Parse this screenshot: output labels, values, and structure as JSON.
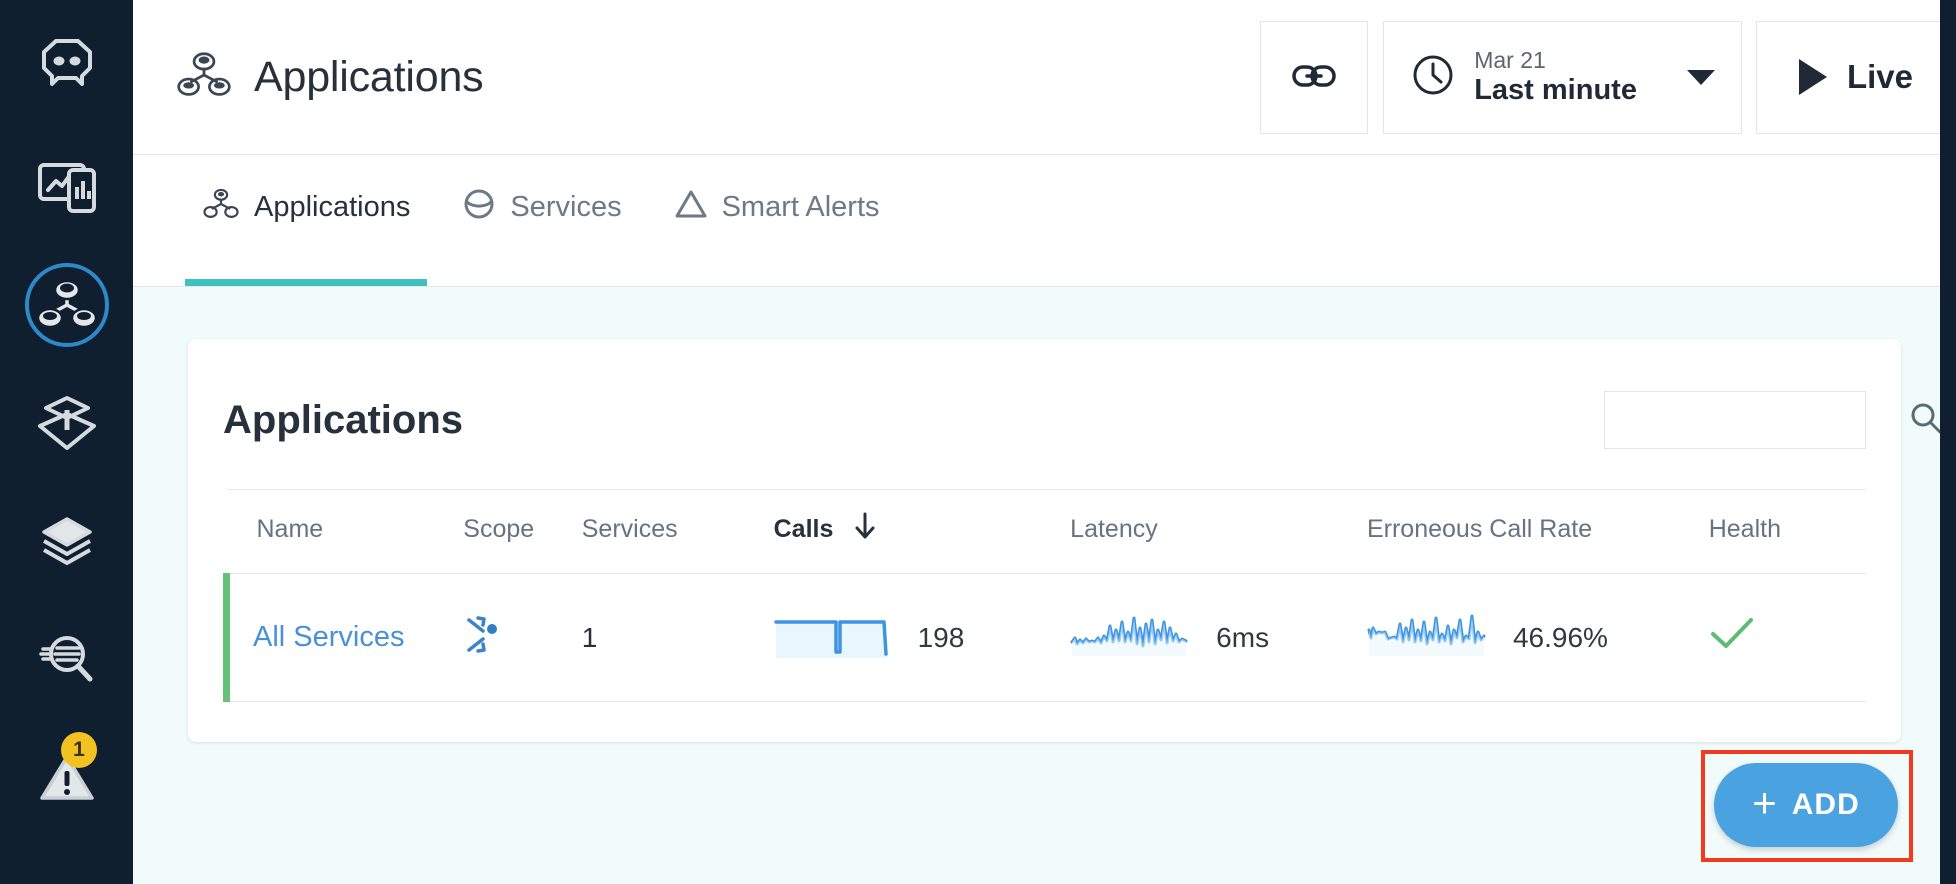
{
  "sidebar": {
    "items": [
      {
        "name": "logo",
        "icon": "robot-logo-icon",
        "label": ""
      },
      {
        "name": "dashboards",
        "icon": "dashboard-icon",
        "label": ""
      },
      {
        "name": "applications",
        "icon": "applications-icon",
        "label": "",
        "active": true
      },
      {
        "name": "infrastructure",
        "icon": "infrastructure-icon",
        "label": ""
      },
      {
        "name": "websites",
        "icon": "stack-layers-icon",
        "label": ""
      },
      {
        "name": "analyze",
        "icon": "search-analyze-icon",
        "label": ""
      },
      {
        "name": "events",
        "icon": "warning-triangle-icon",
        "label": "",
        "badge": "1"
      }
    ]
  },
  "header": {
    "title": "Applications",
    "title_icon": "applications-icon",
    "link_button": {
      "label": "",
      "icon": "link-icon"
    },
    "timepicker": {
      "icon": "clock-icon",
      "date": "Mar 21",
      "range": "Last minute",
      "caret_icon": "chevron-down-icon"
    },
    "live": {
      "label": "Live",
      "icon": "play-icon"
    }
  },
  "tabs": [
    {
      "label": "Applications",
      "icon": "applications-icon",
      "active": true
    },
    {
      "label": "Services",
      "icon": "services-icon",
      "active": false
    },
    {
      "label": "Smart Alerts",
      "icon": "alert-triangle-icon",
      "active": false
    }
  ],
  "card": {
    "title": "Applications",
    "search": {
      "value": "",
      "placeholder": "",
      "icon": "search-icon"
    }
  },
  "table": {
    "columns": [
      {
        "key": "name",
        "label": "Name",
        "sorted": false
      },
      {
        "key": "scope",
        "label": "Scope",
        "sorted": false
      },
      {
        "key": "services",
        "label": "Services",
        "sorted": false
      },
      {
        "key": "calls",
        "label": "Calls",
        "sorted": true,
        "sort_dir": "desc",
        "sort_icon": "arrow-down-icon"
      },
      {
        "key": "latency",
        "label": "Latency",
        "sorted": false
      },
      {
        "key": "erroneous_call_rate",
        "label": "Erroneous Call Rate",
        "sorted": false
      },
      {
        "key": "health",
        "label": "Health",
        "sorted": false
      }
    ],
    "rows": [
      {
        "name": "All Services",
        "scope_icon": "scope-inbound-outbound-icon",
        "services": "1",
        "calls": "198",
        "latency": "6ms",
        "erroneous_call_rate": "46.96%",
        "health_icon": "check-icon",
        "health_status": "healthy",
        "status_color": "#64c07a"
      }
    ]
  },
  "add_button": {
    "label": "ADD",
    "icon": "plus-icon",
    "highlight_color": "#f5391e"
  },
  "colors": {
    "rail_background": "#101f30",
    "content_background": "#f1fbfa",
    "accent_teal": "#3fc1c0",
    "accent_blue": "#4aa3e0",
    "link_blue": "#4a90d9",
    "spark_blue": "#4a9fe0",
    "health_green": "#64c07a",
    "badge_yellow": "#f2c222"
  }
}
